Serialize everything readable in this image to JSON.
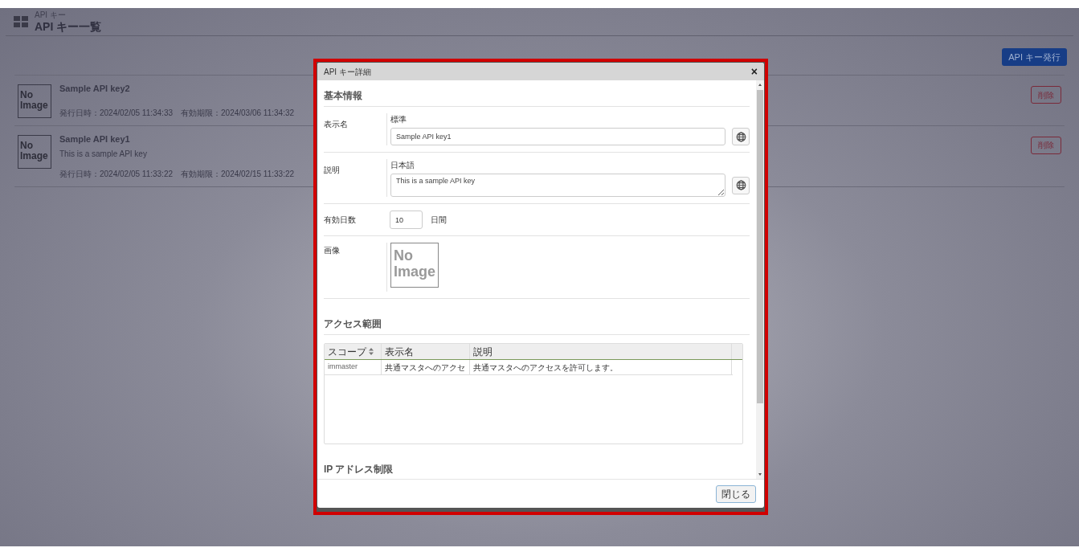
{
  "header": {
    "breadcrumb": "API キー",
    "title": "API キー一覧"
  },
  "issue_button": "API キー発行",
  "keys": [
    {
      "thumbnail": "No Image",
      "name": "Sample API key2",
      "issued": "発行日時：2024/02/05 11:34:33",
      "expires": "有効期限：2024/03/06 11:34:32",
      "delete": "削除"
    },
    {
      "thumbnail": "No Image",
      "name": "Sample API key1",
      "description": "This is a sample API key",
      "issued": "発行日時：2024/02/05 11:33:22",
      "expires": "有効期限：2024/02/15 11:33:22",
      "delete": "削除"
    }
  ],
  "dialog": {
    "title": "API キー詳細",
    "close_icon": "×",
    "basic": {
      "heading": "基本情報",
      "display_name": {
        "label": "表示名",
        "sublabel": "標準",
        "value": "Sample API key1"
      },
      "description": {
        "label": "説明",
        "sublabel": "日本語",
        "value": "This is a sample API key"
      },
      "valid_days": {
        "label": "有効日数",
        "value": "10",
        "unit": "日間"
      },
      "image": {
        "label": "画像",
        "thumbnail": "No Image"
      }
    },
    "access": {
      "heading": "アクセス範囲",
      "columns": [
        "スコープ",
        "表示名",
        "説明"
      ],
      "rows": [
        [
          "immaster",
          "共通マスタへのアクセ",
          "共通マスタへのアクセスを許可します。"
        ]
      ]
    },
    "ip_heading": "IP アドレス制限",
    "close_button": "閉じる"
  }
}
